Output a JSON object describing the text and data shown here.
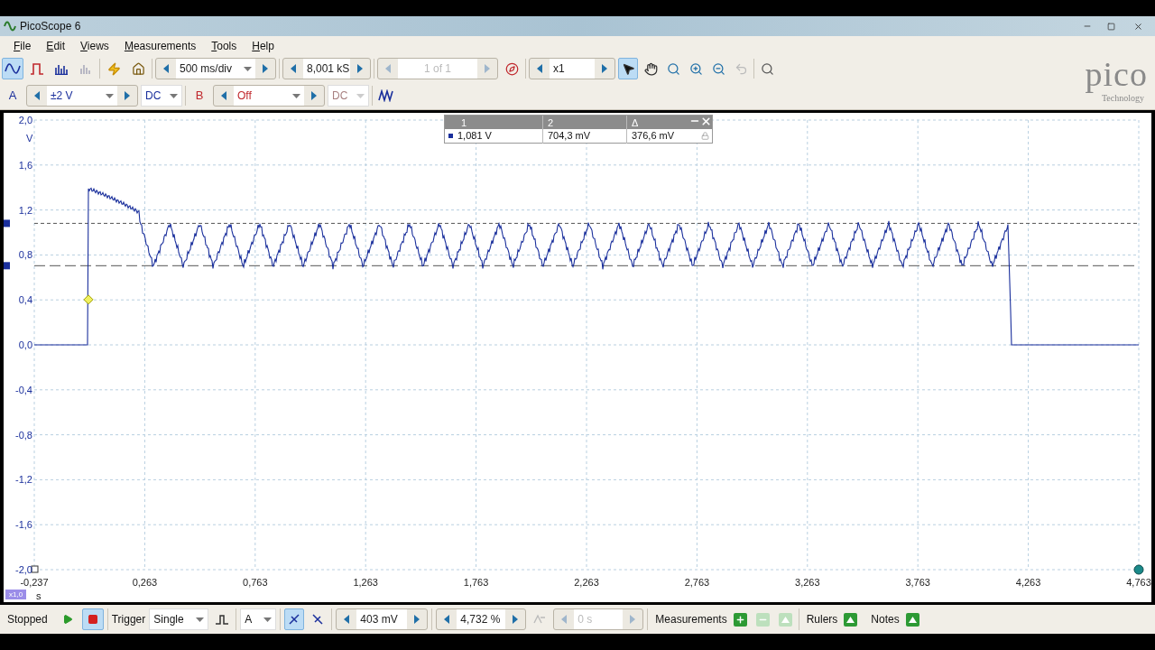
{
  "window": {
    "title": "PicoScope 6"
  },
  "menu": [
    {
      "label": "File"
    },
    {
      "label": "Edit"
    },
    {
      "label": "Views"
    },
    {
      "label": "Measurements"
    },
    {
      "label": "Tools"
    },
    {
      "label": "Help"
    }
  ],
  "toolbar": {
    "modes": [
      {
        "kind": "scope",
        "selected": true,
        "disabled": false
      },
      {
        "kind": "persistence",
        "selected": false,
        "disabled": false
      },
      {
        "kind": "spectrum",
        "selected": false,
        "disabled": false
      },
      {
        "kind": "math",
        "selected": false,
        "disabled": true
      }
    ],
    "timebase": "500 ms/div",
    "samples": "8,001 kS",
    "buffer": {
      "value": "1 of 1",
      "disabled": true
    },
    "zoom": "x1",
    "tools": [
      {
        "kind": "pointer",
        "selected": true,
        "disabled": false
      },
      {
        "kind": "hand",
        "selected": false,
        "disabled": false
      },
      {
        "kind": "zoom-area",
        "selected": false,
        "disabled": false
      },
      {
        "kind": "zoom-in",
        "selected": false,
        "disabled": false
      },
      {
        "kind": "zoom-out",
        "selected": false,
        "disabled": false
      },
      {
        "kind": "undo",
        "selected": false,
        "disabled": true
      },
      {
        "kind": "zoom-fit",
        "selected": false,
        "disabled": false
      }
    ]
  },
  "channels": [
    {
      "label": "A",
      "range": "±2 V",
      "coupling": "DC",
      "enabled": true,
      "color": "#1a2f9c"
    },
    {
      "label": "B",
      "range": "Off",
      "coupling": "DC",
      "enabled": false,
      "color": "#c0282d"
    }
  ],
  "logo": {
    "name": "pico",
    "tagline": "Technology"
  },
  "graph": {
    "y_unit": "V",
    "y_ticks": [
      "2,0",
      "1,6",
      "1,2",
      "0,8",
      "0,4",
      "0,0",
      "-0,4",
      "-0,8",
      "-1,2",
      "-1,6",
      "-2,0"
    ],
    "x_ticks": [
      "-0,237",
      "0,263",
      "0,763",
      "1,263",
      "1,763",
      "2,263",
      "2,763",
      "3,263",
      "3,763",
      "4,263",
      "4,763"
    ],
    "x_unit": "s",
    "x_zoom": "x1,0"
  },
  "rulers_table": {
    "columns": [
      "1",
      "2",
      "Δ"
    ],
    "values": [
      "1,081 V",
      "704,3 mV",
      "376,6 mV"
    ]
  },
  "status_bar": {
    "state": "Stopped",
    "run_buttons": [
      {
        "kind": "play",
        "selected": false
      },
      {
        "kind": "stop",
        "selected": true
      }
    ],
    "trigger_label": "Trigger",
    "trigger_mode": "Single",
    "trigger_source": "A",
    "edge_buttons": [
      {
        "kind": "rising",
        "selected": true
      },
      {
        "kind": "falling",
        "selected": false
      }
    ],
    "threshold": "403 mV",
    "pre_trigger": "4,732 %",
    "delay": {
      "value": "0 s",
      "disabled": true
    },
    "measurements": {
      "label": "Measurements",
      "buttons": [
        {
          "kind": "add",
          "disabled": false
        },
        {
          "kind": "remove",
          "disabled": true
        },
        {
          "kind": "edit",
          "disabled": true
        }
      ]
    },
    "rulers": "Rulers",
    "notes": "Notes"
  }
}
